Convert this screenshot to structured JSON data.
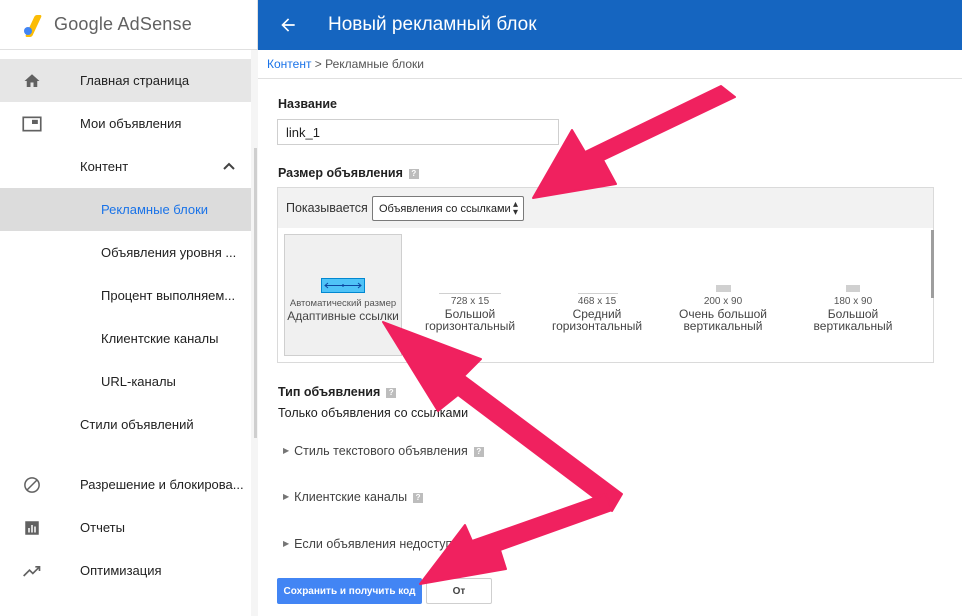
{
  "app": {
    "brand": "Google AdSense"
  },
  "header": {
    "title": "Новый рекламный блок"
  },
  "breadcrumb": {
    "link": "Контент",
    "separator": " > ",
    "current": "Рекламные блоки"
  },
  "sidebar": {
    "items": [
      {
        "label": "Главная страница",
        "icon": "home-icon"
      },
      {
        "label": "Мои объявления",
        "icon": "ads-icon"
      },
      {
        "label": "Контент"
      },
      {
        "label": "Рекламные блоки"
      },
      {
        "label": "Объявления уровня ..."
      },
      {
        "label": "Процент выполняем..."
      },
      {
        "label": "Клиентские каналы"
      },
      {
        "label": "URL-каналы"
      },
      {
        "label": "Стили объявлений"
      },
      {
        "label": "Разрешение и блокирова...",
        "icon": "block-icon"
      },
      {
        "label": "Отчеты",
        "icon": "reports-icon"
      },
      {
        "label": "Оптимизация",
        "icon": "optimization-icon"
      }
    ]
  },
  "form": {
    "name_label": "Название",
    "name_value": "link_1",
    "size_label": "Размер объявления",
    "help": "?",
    "show_label": "Показывается",
    "show_value": "Объявления со ссылками",
    "sizes": [
      {
        "dim": "Автоматический размер",
        "name": "Адаптивные ссылки"
      },
      {
        "dim": "728 x 15",
        "name1": "Большой",
        "name2": "горизонтальный"
      },
      {
        "dim": "468 x 15",
        "name1": "Средний",
        "name2": "горизонтальный"
      },
      {
        "dim": "200 x 90",
        "name1": "Очень большой",
        "name2": "вертикальный"
      },
      {
        "dim": "180 x 90",
        "name1": "Большой",
        "name2": "вертикальный"
      }
    ],
    "type_label": "Тип объявления",
    "type_desc": "Только объявления со ссылками",
    "sections": [
      {
        "label": "Стиль текстового объявления"
      },
      {
        "label": "Клиентские каналы"
      },
      {
        "label": "Если объявления недоступны"
      }
    ],
    "save_button": "Сохранить и получить код",
    "cancel_button": "От"
  },
  "colors": {
    "header": "#1565c0",
    "primary_button": "#4285f4",
    "arrow": "#f0215f",
    "link": "#1a73e8"
  }
}
